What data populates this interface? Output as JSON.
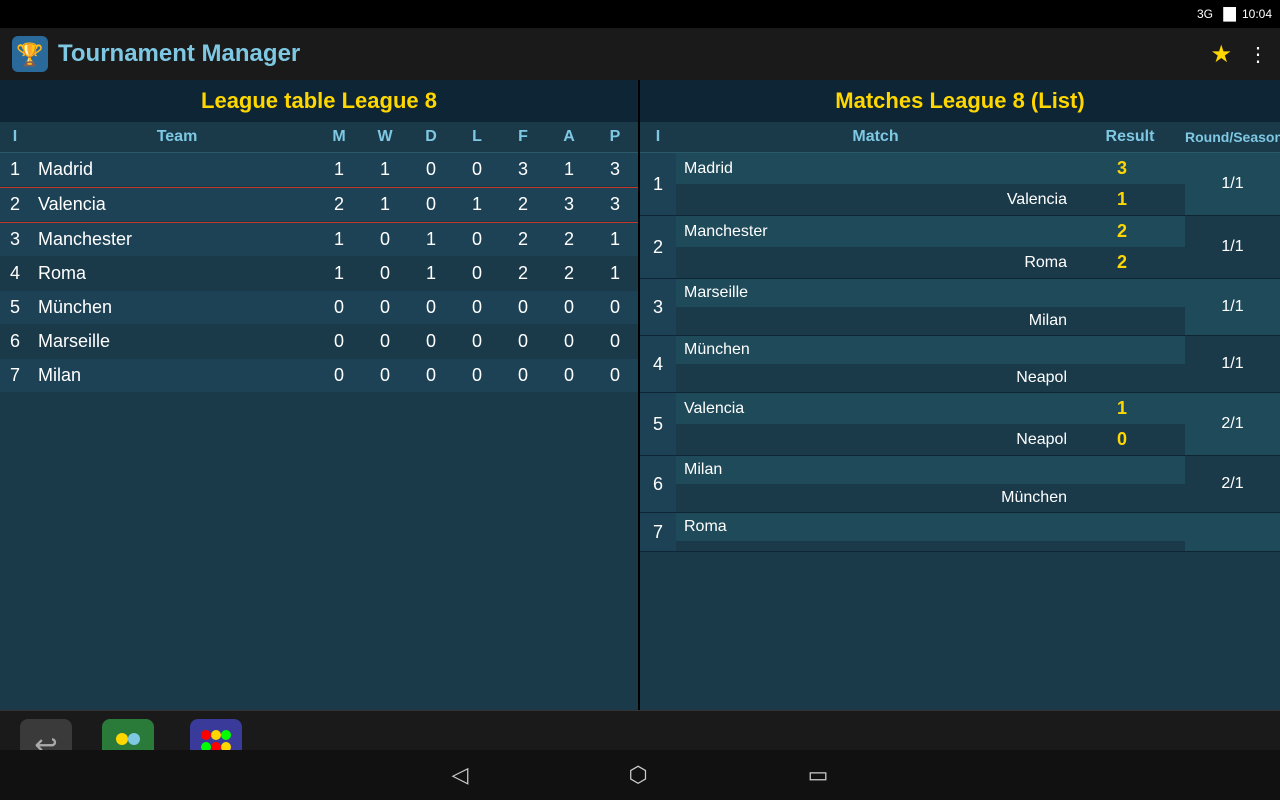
{
  "statusBar": {
    "signal": "3G",
    "battery": "🔋",
    "time": "10:04"
  },
  "titleBar": {
    "appTitle": "Tournament Manager",
    "starIcon": "★",
    "menuIcon": "⋮"
  },
  "leftPanel": {
    "title": "League table League 8",
    "headers": {
      "i": "I",
      "team": "Team",
      "m": "M",
      "w": "W",
      "d": "D",
      "l": "L",
      "f": "F",
      "a": "A",
      "p": "P"
    },
    "rows": [
      {
        "pos": 1,
        "team": "Madrid",
        "m": 1,
        "w": 1,
        "d": 0,
        "l": 0,
        "f": 3,
        "a": 1,
        "p": 3
      },
      {
        "pos": 2,
        "team": "Valencia",
        "m": 2,
        "w": 1,
        "d": 0,
        "l": 1,
        "f": 2,
        "a": 3,
        "p": 3
      },
      {
        "pos": 3,
        "team": "Manchester",
        "m": 1,
        "w": 0,
        "d": 1,
        "l": 0,
        "f": 2,
        "a": 2,
        "p": 1
      },
      {
        "pos": 4,
        "team": "Roma",
        "m": 1,
        "w": 0,
        "d": 1,
        "l": 0,
        "f": 2,
        "a": 2,
        "p": 1
      },
      {
        "pos": 5,
        "team": "München",
        "m": 0,
        "w": 0,
        "d": 0,
        "l": 0,
        "f": 0,
        "a": 0,
        "p": 0
      },
      {
        "pos": 6,
        "team": "Marseille",
        "m": 0,
        "w": 0,
        "d": 0,
        "l": 0,
        "f": 0,
        "a": 0,
        "p": 0
      },
      {
        "pos": 7,
        "team": "Milan",
        "m": 0,
        "w": 0,
        "d": 0,
        "l": 0,
        "f": 0,
        "a": 0,
        "p": 0
      }
    ]
  },
  "rightPanel": {
    "title": "Matches League 8 (List)",
    "headers": {
      "i": "I",
      "match": "Match",
      "result": "Result",
      "round": "Round/Season"
    },
    "matches": [
      {
        "idx": 1,
        "home": "Madrid",
        "homeScore": "3",
        "away": "Valencia",
        "awayScore": "1",
        "round": "1/1"
      },
      {
        "idx": 2,
        "home": "Manchester",
        "homeScore": "2",
        "away": "Roma",
        "awayScore": "2",
        "round": "1/1"
      },
      {
        "idx": 3,
        "home": "Marseille",
        "homeScore": "",
        "away": "Milan",
        "awayScore": "",
        "round": "1/1"
      },
      {
        "idx": 4,
        "home": "München",
        "homeScore": "",
        "away": "Neapol",
        "awayScore": "",
        "round": "1/1"
      },
      {
        "idx": 5,
        "home": "Valencia",
        "homeScore": "1",
        "away": "Neapol",
        "awayScore": "0",
        "round": "2/1"
      },
      {
        "idx": 6,
        "home": "Milan",
        "homeScore": "",
        "away": "München",
        "awayScore": "",
        "round": "2/1"
      },
      {
        "idx": 7,
        "home": "Roma",
        "homeScore": "",
        "away": "",
        "awayScore": "",
        "round": ""
      }
    ]
  },
  "bottomBar": {
    "closeLabel": "Close",
    "teamsLabel": "Teams",
    "matchesLabel": "Matches"
  }
}
